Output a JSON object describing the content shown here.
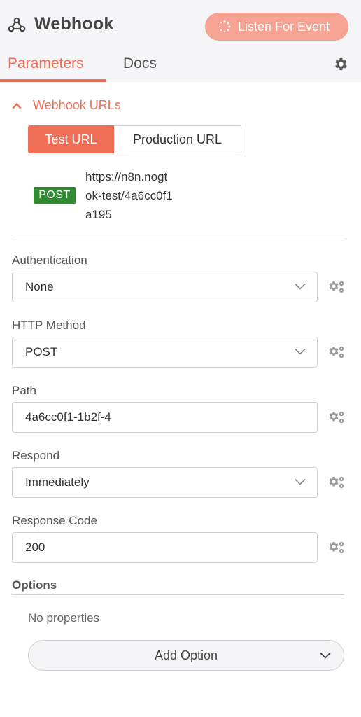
{
  "header": {
    "title": "Webhook",
    "listen_button": "Listen For Event",
    "logo_icon": "webhook-logo-icon",
    "settings_icon": "gear-icon"
  },
  "tabs": [
    {
      "label": "Parameters",
      "active": true
    },
    {
      "label": "Docs",
      "active": false
    }
  ],
  "webhook_urls": {
    "title": "Webhook URLs",
    "toggle": {
      "test": "Test URL",
      "production": "Production URL",
      "selected": "Test URL"
    },
    "method": "POST",
    "url_lines": [
      "https://n8n.nogt",
      "ok-test/4a6cc0f1",
      "a195"
    ]
  },
  "fields": {
    "authentication": {
      "label": "Authentication",
      "value": "None"
    },
    "http_method": {
      "label": "HTTP Method",
      "value": "POST"
    },
    "path": {
      "label": "Path",
      "value": "4a6cc0f1-1b2f-4"
    },
    "respond": {
      "label": "Respond",
      "value": "Immediately"
    },
    "response_code": {
      "label": "Response Code",
      "value": "200"
    }
  },
  "options": {
    "label": "Options",
    "empty_text": "No properties",
    "add_button": "Add Option"
  },
  "colors": {
    "accent": "#ef6f57",
    "listen_button_bg": "#f6a394",
    "post_badge": "#2f8a32"
  }
}
